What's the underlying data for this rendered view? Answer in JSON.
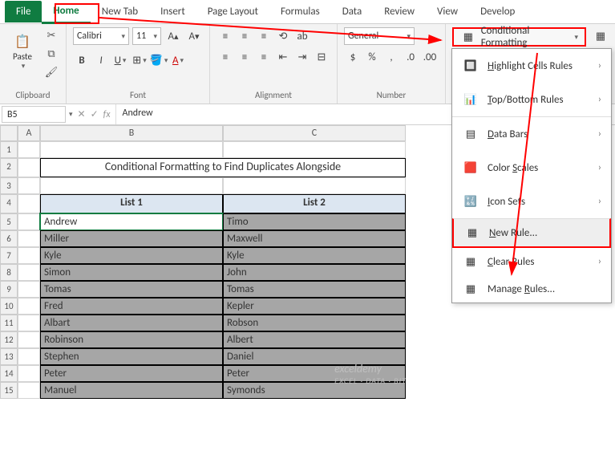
{
  "tabs": {
    "file": "File",
    "home": "Home",
    "newTab": "New Tab",
    "insert": "Insert",
    "pageLayout": "Page Layout",
    "formulas": "Formulas",
    "data": "Data",
    "review": "Review",
    "view": "View",
    "developer": "Develop"
  },
  "ribbon": {
    "clipboard": {
      "label": "Clipboard",
      "paste": "Paste"
    },
    "font": {
      "label": "Font",
      "name": "Calibri",
      "size": "11"
    },
    "alignment": {
      "label": "Alignment"
    },
    "number": {
      "label": "Number",
      "format": "General"
    },
    "styles": {
      "cf": "Conditional Formatting"
    }
  },
  "cf_menu": {
    "highlight": "Highlight Cells Rules",
    "topbottom": "Top/Bottom Rules",
    "databars": "Data Bars",
    "colorscales": "Color Scales",
    "iconsets": "Icon Sets",
    "newrule": "New Rule...",
    "clear": "Clear Rules",
    "manage": "Manage Rules..."
  },
  "namebox": "B5",
  "formula": "Andrew",
  "sheet": {
    "title": "Conditional Formatting to Find Duplicates Alongside",
    "headers": {
      "col1": "List 1",
      "col2": "List 2"
    },
    "rows": [
      {
        "b": "Andrew",
        "c": "Timo"
      },
      {
        "b": "Miller",
        "c": "Maxwell"
      },
      {
        "b": "Kyle",
        "c": "Kyle"
      },
      {
        "b": "Simon",
        "c": "John"
      },
      {
        "b": "Tomas",
        "c": "Tomas"
      },
      {
        "b": "Fred",
        "c": "Kepler"
      },
      {
        "b": "Albart",
        "c": "Robson"
      },
      {
        "b": "Robinson",
        "c": "Albert"
      },
      {
        "b": "Stephen",
        "c": "Daniel"
      },
      {
        "b": "Peter",
        "c": "Peter"
      },
      {
        "b": "Manuel",
        "c": "Symonds"
      }
    ]
  },
  "watermark": {
    "line1": "exceldemy",
    "line2": "EXCEL · DATA · BIT"
  }
}
